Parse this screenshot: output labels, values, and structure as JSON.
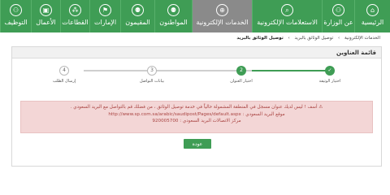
{
  "nav": {
    "items": [
      {
        "label": "الرئيسية",
        "icon": "home-icon",
        "glyph": "⌂"
      },
      {
        "label": "عن الوزارة",
        "icon": "people-icon",
        "glyph": "⚇"
      },
      {
        "label": "الاستعلامات الإلكترونية",
        "icon": "search-icon",
        "glyph": "⌕"
      },
      {
        "label": "الخدمات الإلكترونية",
        "icon": "globe-icon",
        "glyph": "⊕"
      },
      {
        "label": "المواطنون",
        "icon": "citizen-icon",
        "glyph": "⚉"
      },
      {
        "label": "المقيمون",
        "icon": "resident-icon",
        "glyph": "⚉"
      },
      {
        "label": "الإمارات",
        "icon": "emirates-icon",
        "glyph": "⚑"
      },
      {
        "label": "القطاعات",
        "icon": "sectors-icon",
        "glyph": "⁂"
      },
      {
        "label": "الأعمال",
        "icon": "briefcase-icon",
        "glyph": "▣"
      },
      {
        "label": "التوظيف",
        "icon": "employment-icon",
        "glyph": "⚇"
      }
    ]
  },
  "breadcrumb": {
    "items": [
      "الخدمات الإلكترونية",
      "توصيل الوثائق بالبريد",
      "توصيل الوثائق بالبريد"
    ]
  },
  "panel": {
    "title": "قائمة العناوين"
  },
  "steps": [
    {
      "num": "✓",
      "label": "اختيار الوثيقة",
      "state": "done"
    },
    {
      "num": "2",
      "label": "اختيار العنوان",
      "state": "current"
    },
    {
      "num": "3",
      "label": "بيانات التواصل",
      "state": "pending"
    },
    {
      "num": "4",
      "label": "إرسال الطلب",
      "state": "pending"
    }
  ],
  "alert": {
    "line1": "⚠ أسف ! ليس لديك عنوان مسجل في المنطقة المشمولة حالياً في خدمة توصيل الوثائق ، من فضلك قم بالتواصل مع البريد السعودي .",
    "line2": "موقع البريد السعودي : http://www.sp.com.sa/arabic/saudipost/Pages/default.aspx",
    "line3": "مركز الاتصالات البريد السعودي : 920005700"
  },
  "buttons": {
    "back": "عودة"
  },
  "colors": {
    "brand_green": "#3f9d55",
    "active_gray": "#8a8a8a",
    "alert_bg": "#f3d6d6",
    "alert_text": "#a94442"
  }
}
